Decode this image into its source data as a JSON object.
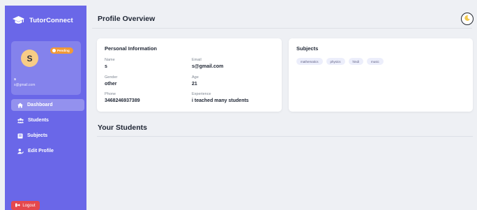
{
  "app": {
    "brand": "TutorConnect"
  },
  "profile": {
    "avatar_initial": "S",
    "status": "Pending",
    "name": "s",
    "email": "s@gmail.com"
  },
  "nav": {
    "items": [
      {
        "label": "Dashboard",
        "icon": "home-icon",
        "active": true
      },
      {
        "label": "Students",
        "icon": "users-icon",
        "active": false
      },
      {
        "label": "Subjects",
        "icon": "book-icon",
        "active": false
      },
      {
        "label": "Edit Profile",
        "icon": "user-edit-icon",
        "active": false
      }
    ],
    "logout": "Logout"
  },
  "header": {
    "title": "Profile Overview",
    "theme_icon": "moon-icon"
  },
  "personal": {
    "title": "Personal Information",
    "fields": [
      {
        "label": "Name",
        "value": "s"
      },
      {
        "label": "Email",
        "value": "s@gmail.com"
      },
      {
        "label": "Gender",
        "value": "other"
      },
      {
        "label": "Age",
        "value": "21"
      },
      {
        "label": "Phone",
        "value": "3468246937389"
      },
      {
        "label": "Experience",
        "value": "i teached many students"
      }
    ]
  },
  "subjects": {
    "title": "Subjects",
    "items": [
      "mathematics",
      "physics",
      "hindi",
      "music"
    ]
  },
  "students": {
    "title": "Your Students"
  },
  "colors": {
    "sidebar": "#6a67e8",
    "accent_pending": "#f29a36",
    "logout": "#e5484d",
    "background": "#eef0f4"
  }
}
